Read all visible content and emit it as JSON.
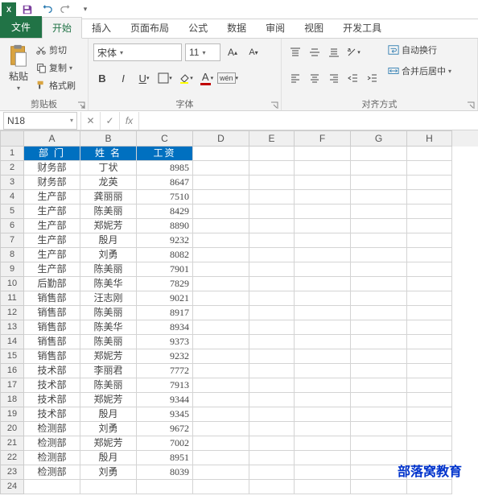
{
  "qat": {
    "app": "X"
  },
  "tabs": {
    "file": "文件",
    "home": "开始",
    "insert": "插入",
    "layout": "页面布局",
    "formula": "公式",
    "data": "数据",
    "review": "审阅",
    "view": "视图",
    "dev": "开发工具"
  },
  "ribbon": {
    "clipboard": {
      "paste": "粘贴",
      "cut": "剪切",
      "copy": "复制",
      "fmtpaint": "格式刷",
      "label": "剪贴板"
    },
    "font": {
      "name": "宋体",
      "size": "11",
      "label": "字体"
    },
    "align": {
      "wrap": "自动换行",
      "merge": "合并后居中",
      "label": "对齐方式"
    }
  },
  "namebox": "N18",
  "columns": [
    "A",
    "B",
    "C",
    "D",
    "E",
    "F",
    "G",
    "H"
  ],
  "widths": [
    "cA",
    "cB",
    "cC",
    "cD",
    "cE",
    "cF",
    "cG",
    "cH"
  ],
  "header": [
    "部 门",
    "姓 名",
    "工资"
  ],
  "rows": [
    [
      "财务部",
      "丁状",
      "8985"
    ],
    [
      "财务部",
      "龙英",
      "8647"
    ],
    [
      "生产部",
      "龚丽丽",
      "7510"
    ],
    [
      "生产部",
      "陈美丽",
      "8429"
    ],
    [
      "生产部",
      "郑妮芳",
      "8890"
    ],
    [
      "生产部",
      "殷月",
      "9232"
    ],
    [
      "生产部",
      "刘勇",
      "8082"
    ],
    [
      "生产部",
      "陈美丽",
      "7901"
    ],
    [
      "后勤部",
      "陈美华",
      "7829"
    ],
    [
      "销售部",
      "汪志刚",
      "9021"
    ],
    [
      "销售部",
      "陈美丽",
      "8917"
    ],
    [
      "销售部",
      "陈美华",
      "8934"
    ],
    [
      "销售部",
      "陈美丽",
      "9373"
    ],
    [
      "销售部",
      "郑妮芳",
      "9232"
    ],
    [
      "技术部",
      "李丽君",
      "7772"
    ],
    [
      "技术部",
      "陈美丽",
      "7913"
    ],
    [
      "技术部",
      "郑妮芳",
      "9344"
    ],
    [
      "技术部",
      "殷月",
      "9345"
    ],
    [
      "检测部",
      "刘勇",
      "9672"
    ],
    [
      "检测部",
      "郑妮芳",
      "7002"
    ],
    [
      "检测部",
      "殷月",
      "8951"
    ],
    [
      "检测部",
      "刘勇",
      "8039"
    ]
  ],
  "watermark": "部落窝教育"
}
